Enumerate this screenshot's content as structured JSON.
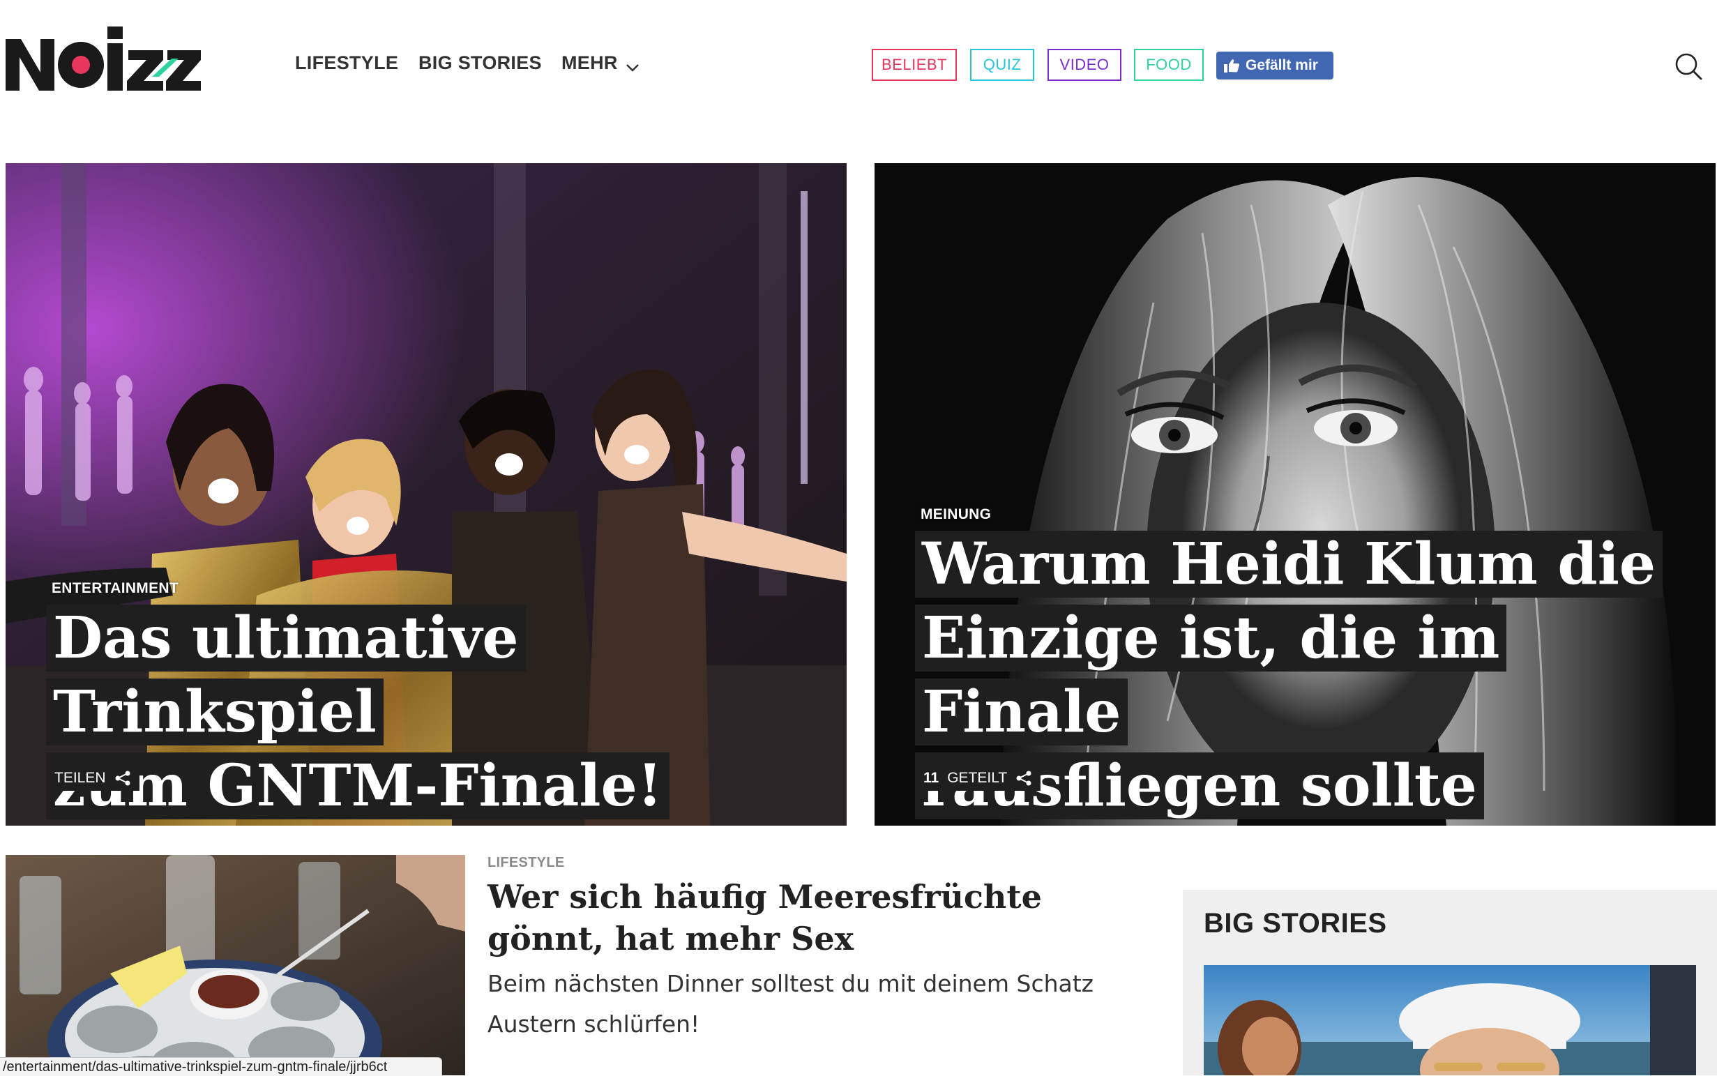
{
  "header": {
    "logo": "NOIZZ",
    "nav": [
      "LIFESTYLE",
      "BIG STORIES",
      "MEHR"
    ],
    "tags": [
      {
        "label": "BELIEBT",
        "color": "#e8365d"
      },
      {
        "label": "QUIZ",
        "color": "#26c6da"
      },
      {
        "label": "VIDEO",
        "color": "#7b2ccf"
      },
      {
        "label": "FOOD",
        "color": "#2ed3a0"
      }
    ],
    "fb_like": "Gefällt mir",
    "icons": {
      "menu_chevron": "chevron-down-icon",
      "search": "search-icon",
      "fb": "thumbs-up-icon"
    }
  },
  "hero_left": {
    "category": "ENTERTAINMENT",
    "headline_lines": [
      "Das ultimative Trinkspiel",
      "zum GNTM-Finale!"
    ],
    "share_label": "TEILEN"
  },
  "hero_right": {
    "category": "MEINUNG",
    "headline_lines": [
      "Warum Heidi Klum die",
      "Einzige ist, die im Finale",
      "rausfliegen sollte"
    ],
    "share_count": "11",
    "share_label": "GETEILT"
  },
  "article": {
    "category": "LIFESTYLE",
    "title": "Wer sich häufig Meeresfrüchte gönnt, hat mehr Sex",
    "teaser": "Beim nächsten Dinner solltest du mit deinem Schatz Austern schlürfen!"
  },
  "sidebar": {
    "title": "BIG STORIES"
  },
  "status_bar": {
    "url": "/entertainment/das-ultimative-trinkspiel-zum-gntm-finale/jjrb6ct"
  },
  "colors": {
    "logo_dot": "#e8365d",
    "logo_accent": "#2ed3a0",
    "headline_bg": "#1f1f1f"
  }
}
